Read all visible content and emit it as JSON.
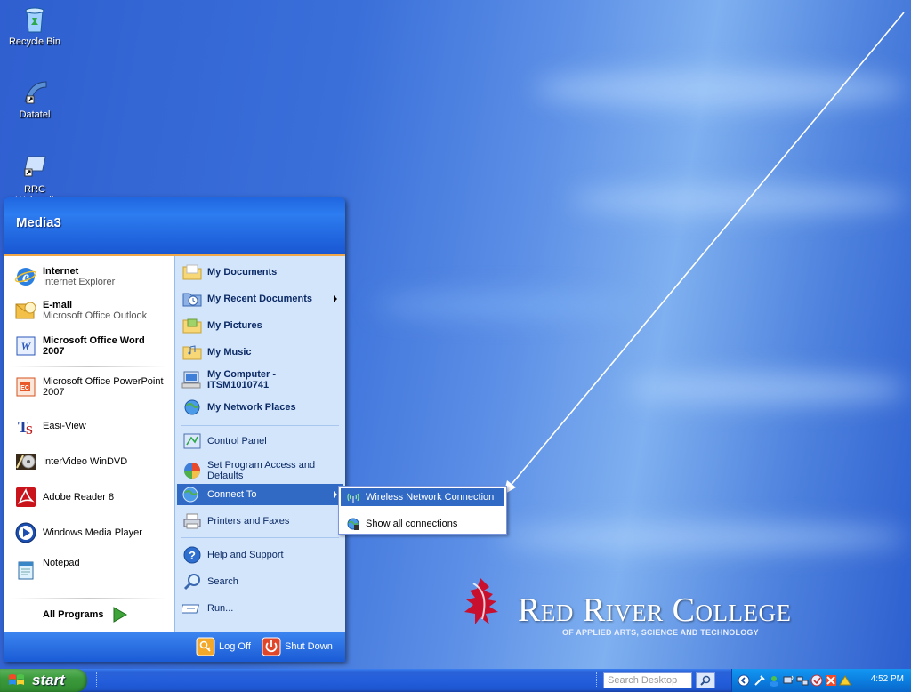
{
  "desktop": {
    "icons": [
      {
        "label": "Recycle Bin",
        "icon": "recycle-bin-icon"
      },
      {
        "label": "Datatel",
        "icon": "datatel-icon"
      },
      {
        "label": "RRC Webmail",
        "icon": "webmail-icon"
      }
    ],
    "logo": {
      "name": "Red River College",
      "tagline": "OF APPLIED ARTS, SCIENCE AND TECHNOLOGY"
    }
  },
  "start_menu": {
    "user": "Media3",
    "left_items": [
      {
        "title": "Internet",
        "subtitle": "Internet Explorer",
        "icon": "internet-explorer-icon"
      },
      {
        "title": "E-mail",
        "subtitle": "Microsoft Office Outlook",
        "icon": "outlook-icon"
      },
      {
        "title": "Microsoft Office Word",
        "title2": "2007",
        "icon": "word-icon"
      },
      {
        "label": "Microsoft Office PowerPoint",
        "label2": "2007",
        "icon": "powerpoint-icon"
      },
      {
        "label": "Easi-View",
        "icon": "easi-view-icon"
      },
      {
        "label": "InterVideo WinDVD",
        "icon": "windvd-icon"
      },
      {
        "label": "Adobe Reader 8",
        "icon": "adobe-reader-icon"
      },
      {
        "label": "Windows Media Player",
        "icon": "media-player-icon"
      },
      {
        "label": "Notepad",
        "icon": "notepad-icon"
      }
    ],
    "all_programs": "All Programs",
    "right_items": [
      {
        "label": "My Documents",
        "icon": "folder-icon"
      },
      {
        "label": "My Recent Documents",
        "icon": "recent-documents-icon"
      },
      {
        "label": "My Pictures",
        "icon": "folder-icon"
      },
      {
        "label": "My Music",
        "icon": "folder-icon"
      },
      {
        "label": "My Computer -",
        "label2": "ITSM1010741",
        "icon": "computer-icon"
      },
      {
        "label": "My Network Places",
        "icon": "network-places-icon"
      },
      {
        "label": "Control Panel",
        "icon": "control-panel-icon"
      },
      {
        "label": "Set Program Access and",
        "label2": "Defaults",
        "icon": "program-access-icon"
      },
      {
        "label": "Connect To",
        "icon": "connect-to-icon"
      },
      {
        "label": "Printers and Faxes",
        "icon": "printer-icon"
      },
      {
        "label": "Help and Support",
        "icon": "help-icon"
      },
      {
        "label": "Search",
        "icon": "search-icon"
      },
      {
        "label": "Run...",
        "icon": "run-icon"
      }
    ],
    "log_off": "Log Off",
    "shut_down": "Shut Down"
  },
  "submenu": {
    "items": [
      {
        "label": "Wireless Network Connection",
        "icon": "wireless-icon"
      },
      {
        "label": "Show all connections",
        "icon": "network-connections-icon"
      }
    ]
  },
  "taskbar": {
    "start_label": "start",
    "search_placeholder": "Search Desktop",
    "clock": "4:52 PM"
  },
  "colors": {
    "menu_highlight": "#316ac5",
    "taskbar_blue": "#245edb",
    "start_green": "#3c9a3c",
    "logo_red": "#c8102e"
  }
}
